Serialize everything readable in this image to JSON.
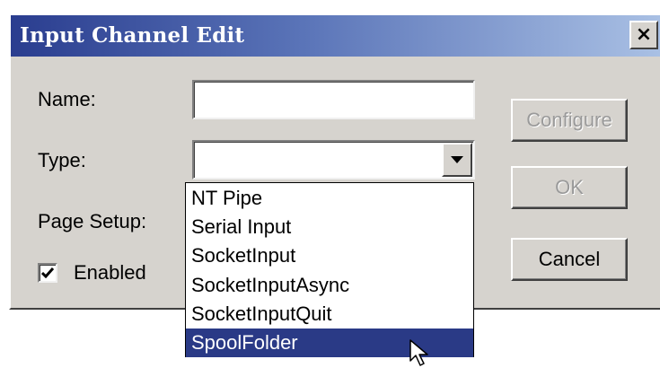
{
  "dialog": {
    "title": "Input Channel Edit",
    "close_label": "×"
  },
  "form": {
    "name_label": "Name:",
    "name_value": "",
    "type_label": "Type:",
    "type_value": "",
    "page_setup_label": "Page Setup:",
    "enabled_label": "Enabled",
    "enabled_checked": true
  },
  "buttons": {
    "configure": "Configure",
    "ok": "OK",
    "cancel": "Cancel"
  },
  "dropdown": {
    "options": [
      "NT Pipe",
      "Serial Input",
      "SocketInput",
      "SocketInputAsync",
      "SocketInputQuit",
      "SpoolFolder"
    ],
    "highlighted_index": 5
  },
  "colors": {
    "titlebar_start": "#2a3d8f",
    "titlebar_end": "#a9c0e4",
    "dialog_face": "#d6d3ce",
    "highlight": "#2a3a86"
  },
  "icons": {
    "close": "close-icon",
    "combo_arrow": "chevron-down-icon",
    "checkmark": "checkmark-icon",
    "cursor": "mouse-pointer-icon"
  }
}
